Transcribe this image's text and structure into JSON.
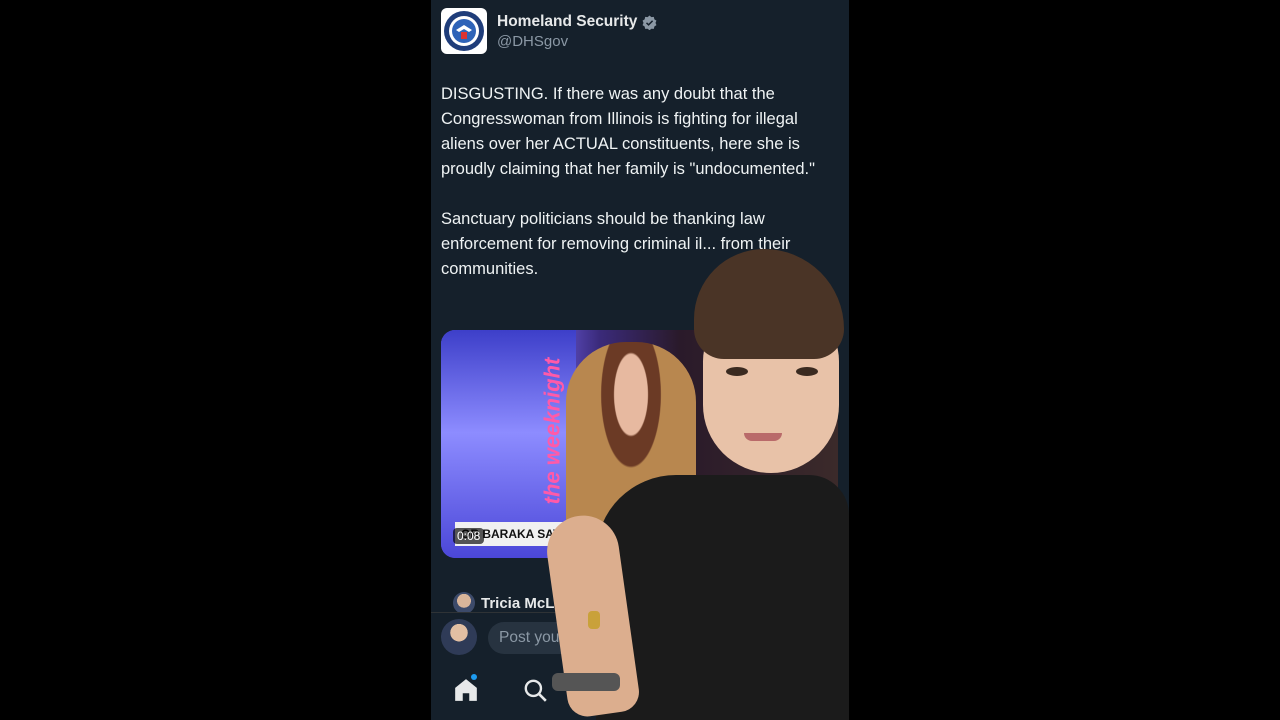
{
  "post": {
    "author_name": "Homeland Security",
    "author_handle": "@DHSgov",
    "paragraph1": "DISGUSTING. If there was any doubt that the Congresswoman from Illinois is fighting for illegal aliens over her ACTUAL constituents, here she is proudly claiming that her family is \"undocumented.\"",
    "paragraph2": "Sanctuary politicians should be thanking law enforcement for removing criminal il... from their communities.",
    "verified": true
  },
  "media": {
    "show_name": "the weeknight",
    "lower_third_text": "OR BARAKA SAYS",
    "timestamp": "0:08"
  },
  "reply": {
    "name": "Tricia McL"
  },
  "composer": {
    "placeholder": "Post you"
  },
  "nav": {
    "icons": [
      "home-icon",
      "search-icon"
    ]
  },
  "colors": {
    "background": "#15202b",
    "accent": "#1d9bf0",
    "text": "#e7e9ea",
    "muted": "#8b98a5"
  }
}
